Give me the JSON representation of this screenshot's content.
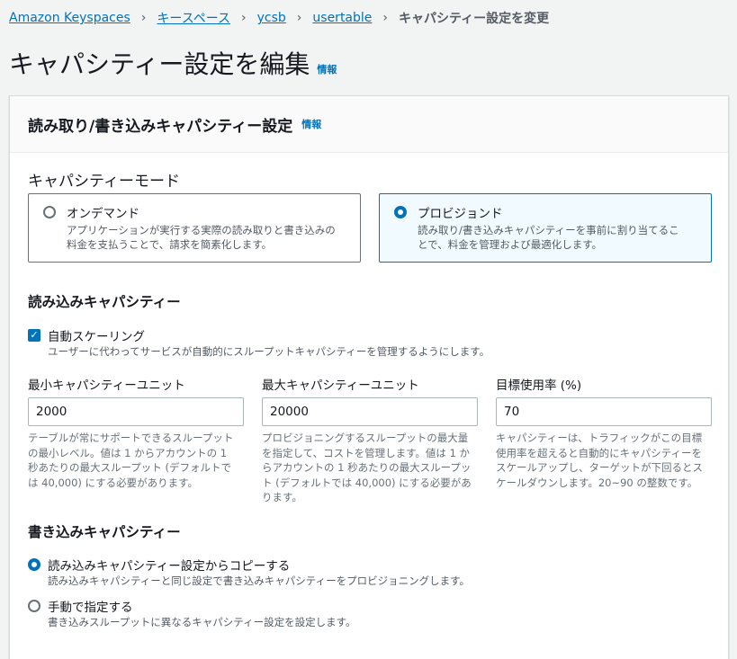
{
  "breadcrumb": {
    "items": [
      "Amazon Keyspaces",
      "キースペース",
      "ycsb",
      "usertable"
    ],
    "current": "キャパシティー設定を変更"
  },
  "page": {
    "title": "キャパシティー設定を編集",
    "info": "情報"
  },
  "panel": {
    "title": "読み取り/書き込みキャパシティー設定",
    "info": "情報"
  },
  "capacity_mode": {
    "label": "キャパシティーモード",
    "options": [
      {
        "title": "オンデマンド",
        "desc_line1": "アプリケーションが実行する実際の読み取りと書き込みの",
        "desc_line2": "料金を支払うことで、請求を簡素化します。",
        "selected": false
      },
      {
        "title": "プロビジョンド",
        "desc_line1": "読み取り/書き込みキャパシティーを事前に割り当てるこ",
        "desc_line2": "とで、料金を管理および最適化します。",
        "selected": true
      }
    ]
  },
  "read_capacity": {
    "title": "読み込みキャパシティー",
    "auto_scaling": {
      "label": "自動スケーリング",
      "desc": "ユーザーに代わってサービスが自動的にスループットキャパシティーを管理するようにします。",
      "checked": true
    },
    "fields": [
      {
        "label": "最小キャパシティーユニット",
        "value": "2000",
        "desc": [
          "テーブルが常にサポートできるスループット",
          "の最小レベル。値は 1 からアカウントの 1",
          "秒あたりの最大スループット (デフォルトで",
          "は 40,000) にする必要があります。"
        ]
      },
      {
        "label": "最大キャパシティーユニット",
        "value": "20000",
        "desc": [
          "プロビジョニングするスループットの最大量",
          "を指定して、コストを管理します。値は 1 か",
          "らアカウントの 1 秒あたりの最大スループッ",
          "ト (デフォルトでは 40,000) にする必要があ",
          "ります。"
        ]
      },
      {
        "label": "目標使用率 (%)",
        "value": "70",
        "desc": [
          "キャパシティーは、トラフィックがこの目標",
          "使用率を超えると自動的にキャパシティーを",
          "スケールアップし、ターゲットが下回るとス",
          "ケールダウンします。20~90 の整数です。"
        ]
      }
    ]
  },
  "write_capacity": {
    "title": "書き込みキャパシティー",
    "options": [
      {
        "title": "読み込みキャパシティー設定からコピーする",
        "desc": "読み込みキャパシティーと同じ設定で書き込みキャパシティーをプロビジョニングします。",
        "selected": true
      },
      {
        "title": "手動で指定する",
        "desc": "書き込みスループットに異なるキャパシティー設定を設定します。",
        "selected": false
      }
    ]
  },
  "colors": {
    "link": "#0073bb",
    "selected_border": "#0073bb",
    "selected_bg": "#f1faff",
    "page_bg": "#f2f3f3"
  }
}
